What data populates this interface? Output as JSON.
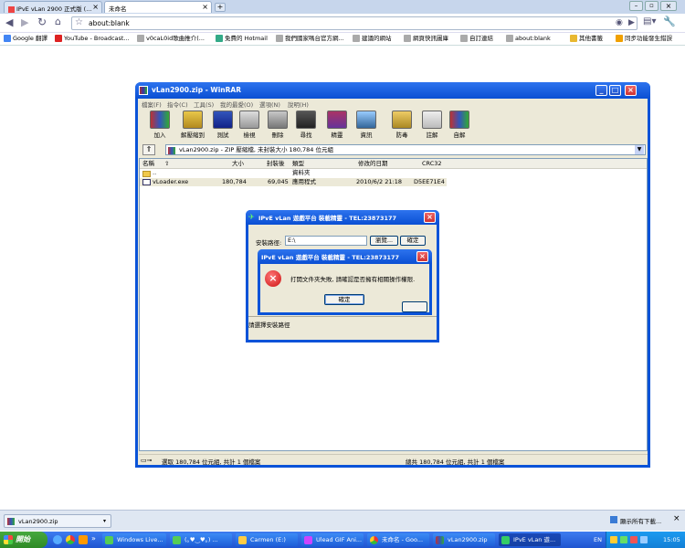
{
  "browser": {
    "tabs": [
      {
        "label": "IPvE vLan 2900 正式版 (..."
      },
      {
        "label": "未命名"
      }
    ],
    "address": "about:blank",
    "bookmarks": [
      "Google 翻譯",
      "YouTube - Broadcast...",
      "v0caL0id歌曲推介(...",
      "免費的 Hotmail",
      "我們國家嗎台官方網...",
      "建議的網站",
      "網頁快訊圖庫",
      "自訂連結",
      "about:blank"
    ],
    "other_bookmarks": "其他書籤",
    "sync_warning": "同步功能發生錯誤"
  },
  "winrar": {
    "title": "vLan2900.zip - WinRAR",
    "menu": [
      "檔案(F)",
      "指令(C)",
      "工具(S)",
      "我的最愛(O)",
      "選項(N)",
      "說明(H)"
    ],
    "toolbar": [
      "加入",
      "解壓縮到",
      "測試",
      "檢視",
      "刪除",
      "尋找",
      "精靈",
      "資訊",
      "防毒",
      "註解",
      "自解"
    ],
    "path": "vLan2900.zip - ZIP 壓縮檔, 未封裝大小 180,784 位元組",
    "columns": [
      "名稱",
      "大小",
      "封裝後",
      "類型",
      "修改的日期",
      "CRC32"
    ],
    "rows": [
      {
        "name": "..",
        "size": "",
        "packed": "",
        "type": "資料夾",
        "modified": "",
        "crc": ""
      },
      {
        "name": "vLoader.exe",
        "size": "180,784",
        "packed": "69,045",
        "type": "應用程式",
        "modified": "2010/6/2 21:18",
        "crc": "D5EE71E4"
      }
    ],
    "status_left": "選取 180,784 位元組, 共計 1 個檔案",
    "status_right": "總共 180,784 位元組, 共計 1 個檔案"
  },
  "installer": {
    "title": "IPvE vLan 遊戲平台 裝載精靈 - TEL:23873177",
    "path_label": "安裝路徑:",
    "path_value": "E:\\",
    "browse_label": "瀏覽...",
    "ok_label": "確定",
    "hint": "請選擇安裝路徑"
  },
  "error_dialog": {
    "title": "IPvE vLan 遊戲平台 裝載精靈 - TEL:23873177",
    "message": "打開文件夾失敗, 請確認是否擁有相關操作權限.",
    "ok_label": "確定"
  },
  "download_bar": {
    "file": "vLan2900.zip",
    "show_all": "顯示所有下載..."
  },
  "taskbar": {
    "start": "開始",
    "items": [
      "Windows Live...",
      "(｡♥‿♥｡) ...",
      "Carmen (E:)",
      "Ulead GIF Ani...",
      "未命名 - Goo...",
      "vLan2900.zip",
      "IPvE vLan 遊..."
    ],
    "lang": "EN",
    "time": "15:05"
  },
  "colors": {
    "xp_blue": "#0a53d8",
    "error_red": "#d8352a",
    "winrar_face": "#ece9d8"
  }
}
